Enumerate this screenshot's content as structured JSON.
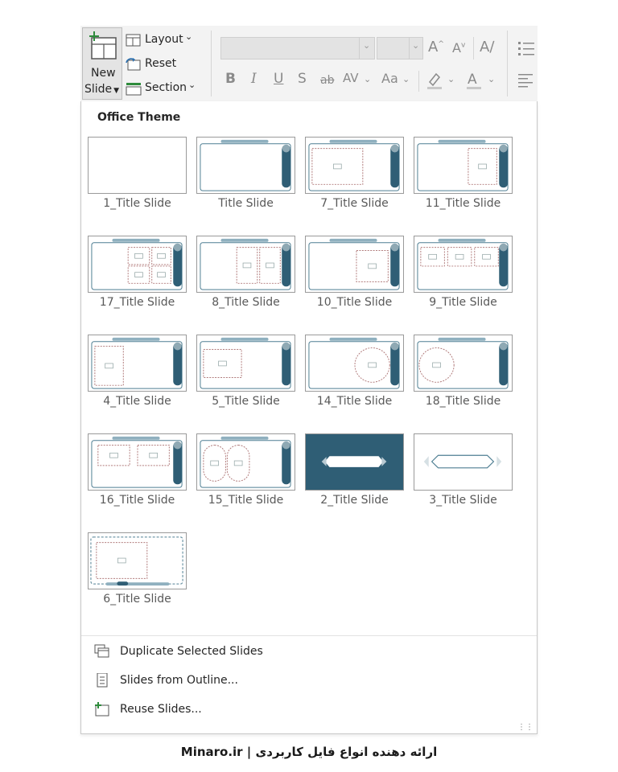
{
  "ribbon": {
    "new_slide_line1": "New",
    "new_slide_line2": "Slide",
    "layout_label": "Layout",
    "reset_label": "Reset",
    "section_label": "Section",
    "format_buttons": [
      "B",
      "I",
      "U",
      "S",
      "ab",
      "AV",
      "Aa"
    ]
  },
  "gallery": {
    "header": "Office Theme",
    "layouts": [
      {
        "label": "1_Title Slide",
        "kind": "blank"
      },
      {
        "label": "Title Slide",
        "kind": "frame"
      },
      {
        "label": "7_Title Slide",
        "kind": "frame-ph-left"
      },
      {
        "label": "11_Title Slide",
        "kind": "frame-ph-right"
      },
      {
        "label": "17_Title Slide",
        "kind": "frame-ph-grid"
      },
      {
        "label": "8_Title Slide",
        "kind": "frame-ph-two"
      },
      {
        "label": "10_Title Slide",
        "kind": "frame-ph-right-sq"
      },
      {
        "label": "9_Title Slide",
        "kind": "frame-ph-three"
      },
      {
        "label": "4_Title Slide",
        "kind": "frame-ph-tall-left"
      },
      {
        "label": "5_Title Slide",
        "kind": "frame-ph-left-wide"
      },
      {
        "label": "14_Title Slide",
        "kind": "frame-circle-right"
      },
      {
        "label": "18_Title Slide",
        "kind": "frame-circle-left"
      },
      {
        "label": "16_Title Slide",
        "kind": "frame-ph-two-top"
      },
      {
        "label": "15_Title Slide",
        "kind": "frame-ovals"
      },
      {
        "label": "2_Title Slide",
        "kind": "dark"
      },
      {
        "label": "3_Title Slide",
        "kind": "hex"
      },
      {
        "label": "6_Title Slide",
        "kind": "frame-bottom"
      }
    ]
  },
  "menu": {
    "duplicate": "Duplicate Selected Slides",
    "outline": "Slides from Outline...",
    "reuse": "Reuse Slides..."
  },
  "footer": "Minaro.ir | ارائه دهنده انواع فایل کاربردی",
  "colors": {
    "accent": "#2f5e75",
    "placeholder": "#b07a7a",
    "frame": "#4f7f93"
  }
}
